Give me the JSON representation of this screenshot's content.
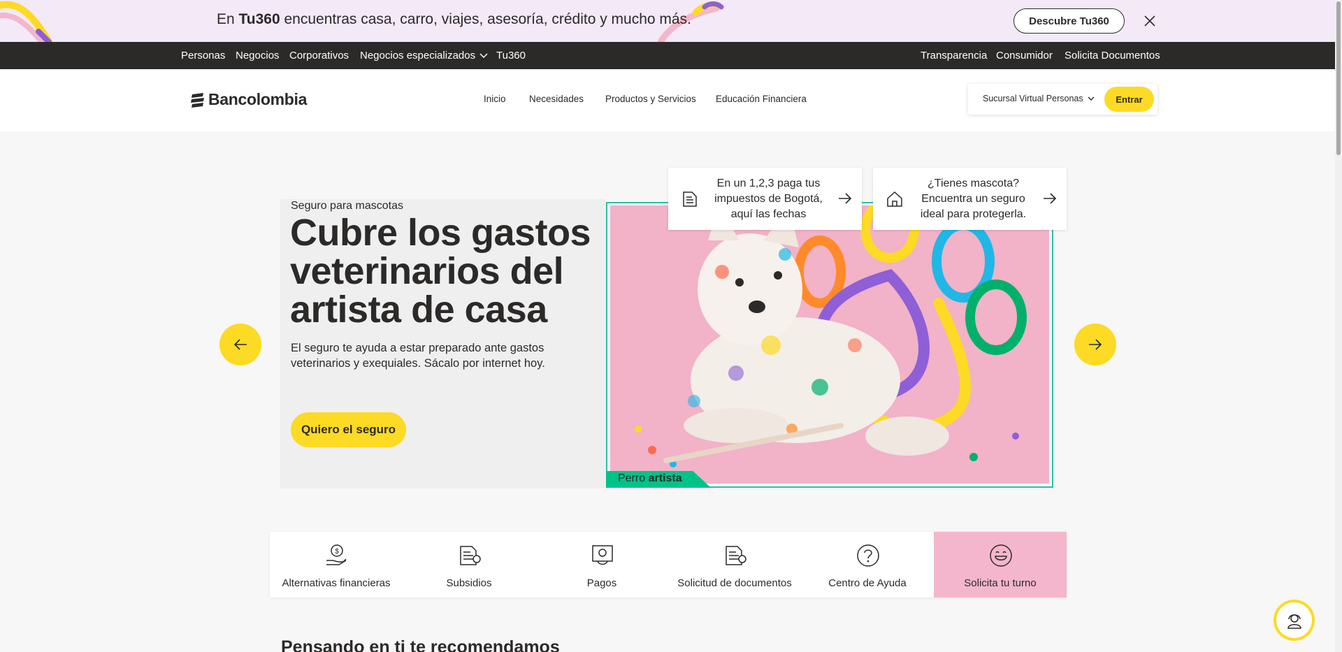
{
  "promo": {
    "text_prefix": "En ",
    "brand": "Tu360",
    "text_suffix": " encuentras casa, carro, viajes, asesoría, crédito y mucho más.",
    "button": "Descubre Tu360"
  },
  "topnav": {
    "left": [
      "Personas",
      "Negocios",
      "Corporativos",
      "Negocios especializados",
      "Tu360"
    ],
    "right": [
      "Transparencia",
      "Consumidor",
      "Solicita Documentos"
    ]
  },
  "header": {
    "logo": "Bancolombia",
    "nav": [
      "Inicio",
      "Necesidades",
      "Productos y Servicios",
      "Educación Financiera"
    ],
    "branch_select": "Sucursal Virtual Personas",
    "login": "Entrar"
  },
  "hero": {
    "eyebrow": "Seguro para mascotas",
    "title": "Cubre los gastos veterinarios del artista de casa",
    "description": "El seguro te ayuda a estar preparado ante gastos veterinarios y exequiales. Sácalo por internet hoy.",
    "cta": "Quiero el seguro",
    "caption_prefix": "Perro ",
    "caption_bold": "artista"
  },
  "quick_cards": [
    {
      "text": "En un 1,2,3 paga tus impuestos de Bogotá, aquí las fechas",
      "icon": "document-icon"
    },
    {
      "text": "¿Tienes mascota? Encuentra un seguro ideal para protegerla.",
      "icon": "house-icon"
    }
  ],
  "services": [
    {
      "label": "Alternativas financieras",
      "icon": "hand-money-icon"
    },
    {
      "label": "Subsidios",
      "icon": "document-icon"
    },
    {
      "label": "Pagos",
      "icon": "payment-icon"
    },
    {
      "label": "Solicitud de documentos",
      "icon": "document-icon"
    },
    {
      "label": "Centro de Ayuda",
      "icon": "question-icon"
    },
    {
      "label": "Solicita tu turno",
      "icon": "smile-icon"
    }
  ],
  "section_title": "Pensando en ti te recomendamos",
  "colors": {
    "yellow": "#fdda24",
    "dark": "#2c2a29",
    "green": "#00c389",
    "pink": "#f4b6cc",
    "lavender": "#f3e9f7"
  }
}
